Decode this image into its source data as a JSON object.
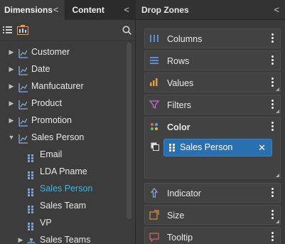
{
  "left_panel": {
    "tabs": [
      {
        "label": "Dimensions",
        "chevron": "<"
      },
      {
        "label": "Content",
        "chevron": "<"
      }
    ],
    "toolbar": {
      "list_view_icon": "list-icon",
      "hierarchy_view_icon": "hierarchy-icon",
      "search_icon": "search-icon"
    },
    "tree": [
      {
        "label": "Customer",
        "type": "hierarchy",
        "expanded": false
      },
      {
        "label": "Date",
        "type": "hierarchy",
        "expanded": false
      },
      {
        "label": "Manfucaturer",
        "type": "hierarchy",
        "expanded": false
      },
      {
        "label": "Product",
        "type": "hierarchy",
        "expanded": false
      },
      {
        "label": "Promotion",
        "type": "hierarchy",
        "expanded": false
      },
      {
        "label": "Sales Person",
        "type": "hierarchy",
        "expanded": true
      },
      {
        "label": "Email",
        "type": "level"
      },
      {
        "label": "LDA Pname",
        "type": "level"
      },
      {
        "label": "Sales Person",
        "type": "level",
        "active": true
      },
      {
        "label": "Sales Team",
        "type": "level"
      },
      {
        "label": "VP",
        "type": "level"
      },
      {
        "label": "Sales Teams",
        "type": "org",
        "expanded": false
      }
    ]
  },
  "drop_zones": {
    "title": "Drop Zones",
    "chevron": "<",
    "zones": [
      {
        "label": "Columns",
        "icon": "columns-icon"
      },
      {
        "label": "Rows",
        "icon": "rows-icon"
      },
      {
        "label": "Values",
        "icon": "values-icon"
      },
      {
        "label": "Filters",
        "icon": "filter-icon"
      },
      {
        "label": "Color",
        "icon": "color-icon"
      },
      {
        "label": "Indicator",
        "icon": "indicator-icon"
      },
      {
        "label": "Size",
        "icon": "size-icon"
      },
      {
        "label": "Tooltip",
        "icon": "tooltip-icon"
      }
    ],
    "color_chip": {
      "label": "Sales Person",
      "close": "✕"
    }
  },
  "colors": {
    "accent_blue": "#3bb7e6",
    "chip_blue": "#2a6fb0",
    "columns": "#5b8fd6",
    "rows": "#5b8fd6",
    "values": "#e0a040",
    "filters": "#c070d0",
    "indicator": "#8fa8e0",
    "size": "#e09040",
    "tooltip": "#e06060"
  }
}
